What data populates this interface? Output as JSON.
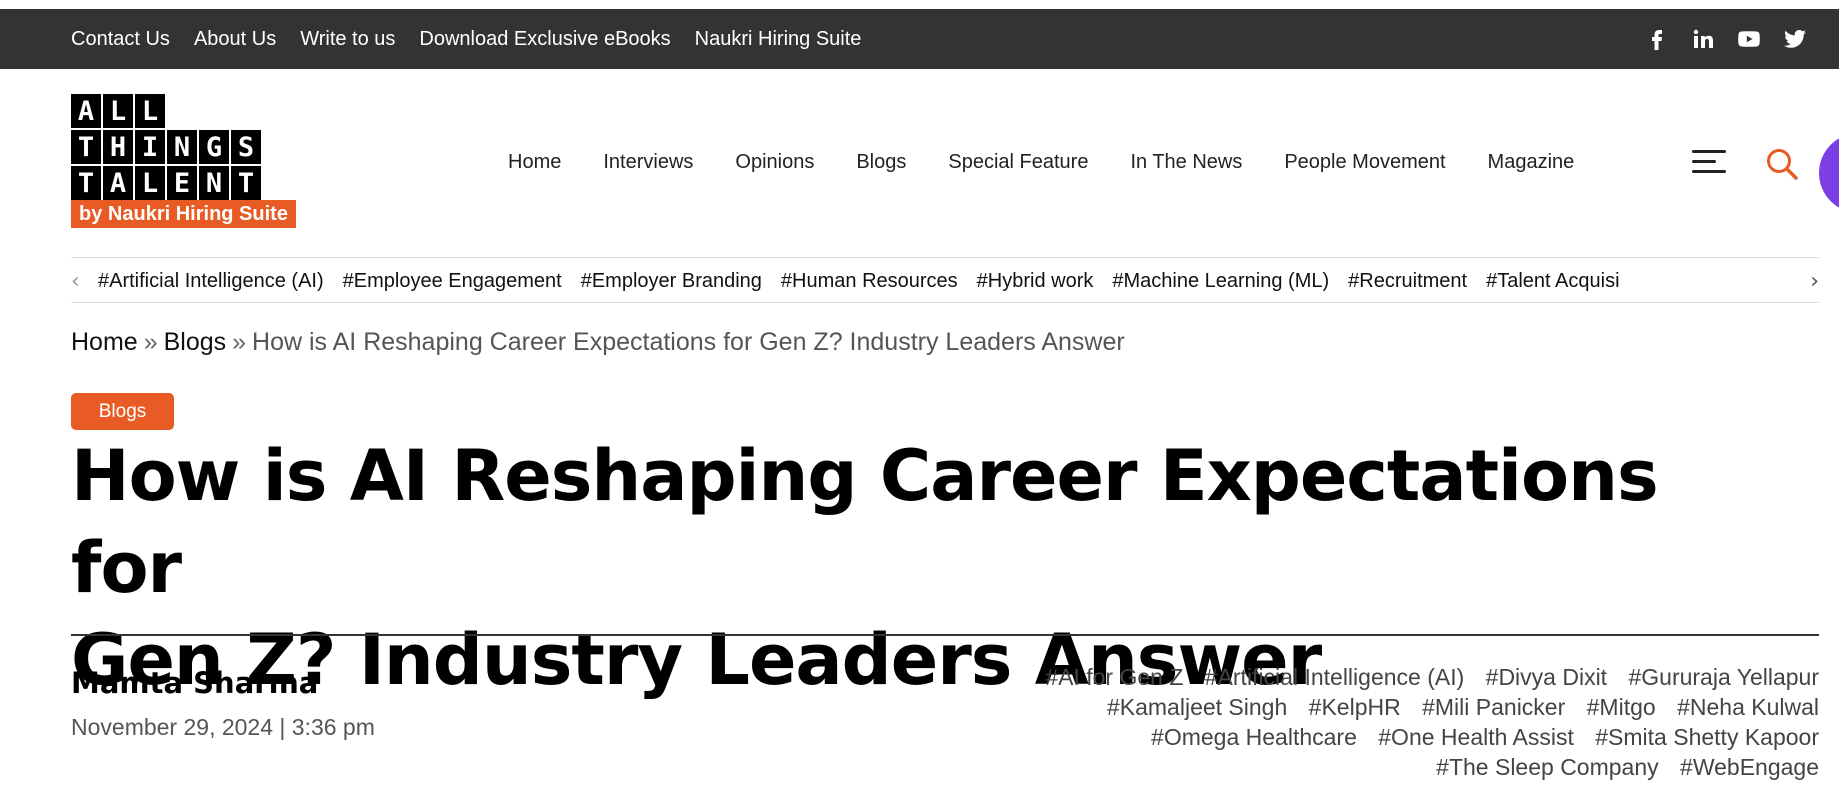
{
  "topbar": {
    "links": [
      "Contact Us",
      "About Us",
      "Write to us",
      "Download Exclusive eBooks",
      "Naukri Hiring Suite"
    ],
    "social_icons": [
      "facebook-icon",
      "linkedin-icon",
      "youtube-icon",
      "twitter-icon"
    ]
  },
  "logo": {
    "rows": [
      [
        "A",
        "L",
        "L"
      ],
      [
        "T",
        "H",
        "I",
        "N",
        "G",
        "S"
      ],
      [
        "T",
        "A",
        "L",
        "E",
        "N",
        "T"
      ]
    ],
    "subtitle": "by Naukri Hiring Suite"
  },
  "nav": {
    "items": [
      "Home",
      "Interviews",
      "Opinions",
      "Blogs",
      "Special Feature",
      "In The News",
      "People Movement",
      "Magazine"
    ]
  },
  "tags": {
    "items": [
      "#Artificial Intelligence (AI)",
      "#Employee Engagement",
      "#Employer Branding",
      "#Human Resources",
      "#Hybrid work",
      "#Machine Learning (ML)",
      "#Recruitment",
      "#Talent Acquisi"
    ],
    "prev": "‹",
    "next": "›"
  },
  "breadcrumb": {
    "home": "Home",
    "sep": "»",
    "section": "Blogs",
    "current": "How is AI Reshaping Career Expectations for Gen Z? Industry Leaders Answer"
  },
  "article": {
    "category": "Blogs",
    "title_line1": "How is AI Reshaping Career Expectations for",
    "title_line2": "Gen Z? Industry Leaders Answer",
    "author": "Mamta Sharma",
    "datetime": "November 29, 2024 | 3:36 pm",
    "tags": [
      "#AI for Gen Z",
      "#Artificial Intelligence (AI)",
      "#Divya Dixit",
      "#Gururaja Yellapur",
      "#Kamaljeet Singh",
      "#KelpHR",
      "#Mili Panicker",
      "#Mitgo",
      "#Neha Kulwal",
      "#Omega Healthcare",
      "#One Health Assist",
      "#Smita Shetty Kapoor",
      "#The Sleep Company",
      "#WebEngage"
    ]
  },
  "colors": {
    "accent": "#e95b24",
    "topbar": "#333333",
    "purple": "#7b3fe4"
  }
}
